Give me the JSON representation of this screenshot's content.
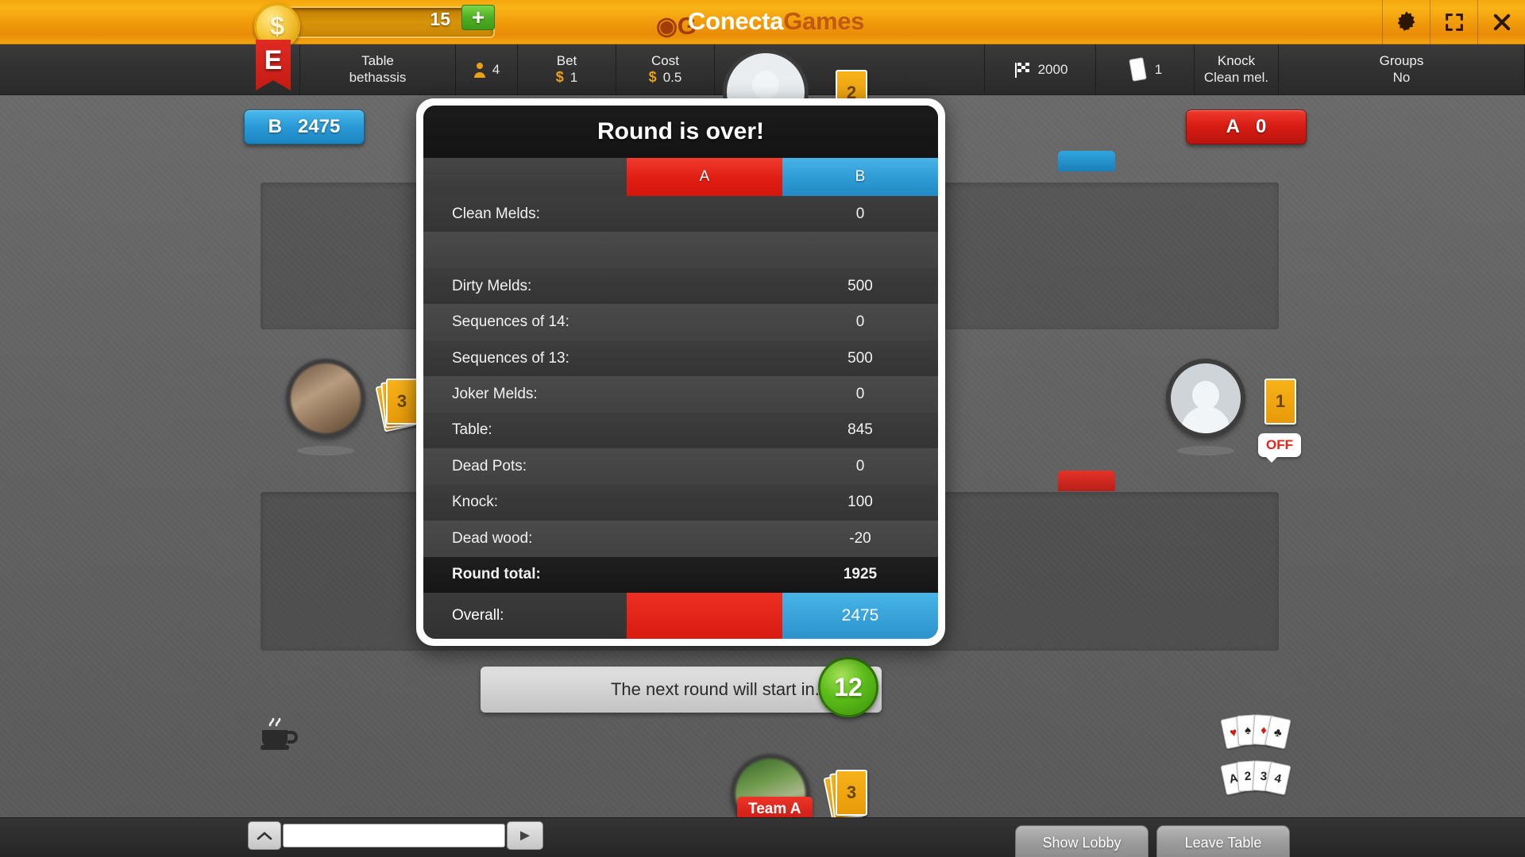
{
  "topbar": {
    "coin_icon": "dollar-coin-icon",
    "coin_amount": "15",
    "add_coins_label": "+",
    "brand_logo": "conectagames-logo-icon",
    "brand_part1": "Conecta",
    "brand_part2": "Games",
    "settings_icon": "gear-icon",
    "fullscreen_icon": "fullscreen-icon",
    "close_icon": "close-icon"
  },
  "infobar": {
    "bookmark_letter": "E",
    "table_label": "Table",
    "table_value": "bethassis",
    "players_icon": "person-icon",
    "players_value": "4",
    "bet_label": "Bet",
    "bet_currency": "$",
    "bet_value": "1",
    "cost_label": "Cost",
    "cost_currency": "$",
    "cost_value": "0.5",
    "goal_icon": "checkered-flag-icon",
    "goal_value": "2000",
    "decks_icon": "card-icon",
    "decks_value": "1",
    "knock_label": "Knock",
    "knock_value": "Clean mel.",
    "groups_label": "Groups",
    "groups_value": "No"
  },
  "table": {
    "chip_b_team": "B",
    "chip_b_score": "2475",
    "chip_a_team": "A",
    "chip_a_score": "0",
    "left_player_cards": "3",
    "top_player_cards": "2",
    "right_player_cards": "1",
    "right_player_status": "OFF",
    "bottom_player_cards": "3",
    "bottom_player_team": "Team A",
    "coffee_icon": "coffee-cup-icon",
    "deck_icon_top": "card-suits-icon",
    "deck_icon_bottom": "card-ranks-icon",
    "deck_rank_labels": [
      "A",
      "2",
      "3",
      "4"
    ]
  },
  "status": {
    "message": "The next round will start in..",
    "countdown": "12"
  },
  "modal": {
    "title": "Round is over!",
    "columns": [
      "A",
      "B"
    ],
    "colors": {
      "team_a": "#e01d13",
      "team_b": "#2e9ad4"
    },
    "rows": [
      {
        "label": "Clean Melds:",
        "a": "",
        "b": "0"
      },
      {
        "label": "",
        "a": "",
        "b": ""
      },
      {
        "label": "Dirty Melds:",
        "a": "",
        "b": "500"
      },
      {
        "label": "Sequences of 14:",
        "a": "",
        "b": "0"
      },
      {
        "label": "Sequences of 13:",
        "a": "",
        "b": "500"
      },
      {
        "label": "Joker Melds:",
        "a": "",
        "b": "0"
      },
      {
        "label": "Table:",
        "a": "",
        "b": "845"
      },
      {
        "label": "Dead Pots:",
        "a": "",
        "b": "0"
      },
      {
        "label": "Knock:",
        "a": "",
        "b": "100"
      },
      {
        "label": "Dead wood:",
        "a": "",
        "b": "-20"
      },
      {
        "label": "Round total:",
        "a": "",
        "b": "1925"
      }
    ],
    "overall_label": "Overall:",
    "overall_a": "",
    "overall_b": "2475"
  },
  "bottombar": {
    "chat_toggle_icon": "chevron-up-icon",
    "chat_placeholder": "",
    "chat_value": "",
    "send_icon": "send-arrow-icon",
    "show_lobby_label": "Show Lobby",
    "leave_table_label": "Leave Table"
  }
}
